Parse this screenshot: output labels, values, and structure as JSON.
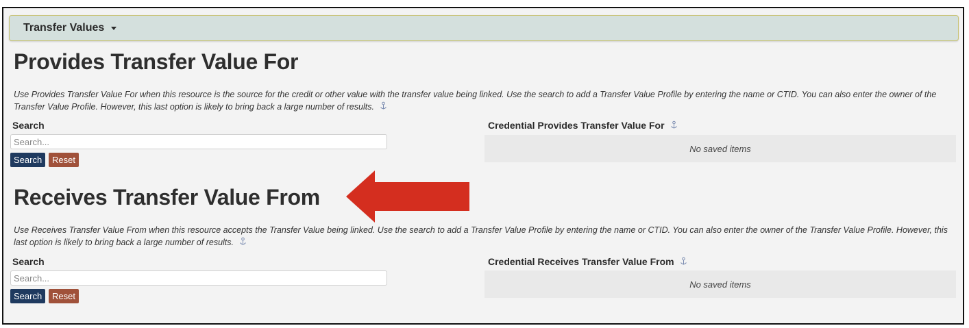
{
  "section_bar": {
    "label": "Transfer Values"
  },
  "provides": {
    "title": "Provides Transfer Value For",
    "description": "Use Provides Transfer Value For when this resource is the source for the credit or other value with the transfer value being linked. Use the search to add a Transfer Value Profile by entering the name or CTID. You can also enter the owner of the Transfer Value Profile. However, this last option is likely to bring back a large number of results.",
    "search_label": "Search",
    "search_placeholder": "Search...",
    "search_button": "Search",
    "reset_button": "Reset",
    "credential_label": "Credential Provides Transfer Value For",
    "saved_items_text": "No saved items"
  },
  "receives": {
    "title": "Receives Transfer Value From",
    "description": "Use Receives Transfer Value From when this resource accepts the Transfer Value being linked. Use the search to add a Transfer Value Profile by entering the name or CTID. You can also enter the owner of the Transfer Value Profile. However, this last option is likely to bring back a large number of results.",
    "search_label": "Search",
    "search_placeholder": "Search...",
    "search_button": "Search",
    "reset_button": "Reset",
    "credential_label": "Credential Receives Transfer Value From",
    "saved_items_text": "No saved items"
  },
  "colors": {
    "section_bar_bg": "#d4e0dd",
    "search_button_bg": "#1f3a5f",
    "reset_button_bg": "#a0513a",
    "annotation_arrow": "#d42e1f"
  },
  "icons": {
    "info": "info-anchor-icon",
    "dropdown": "caret-down-icon",
    "annotation": "left-arrow-annotation-icon"
  }
}
